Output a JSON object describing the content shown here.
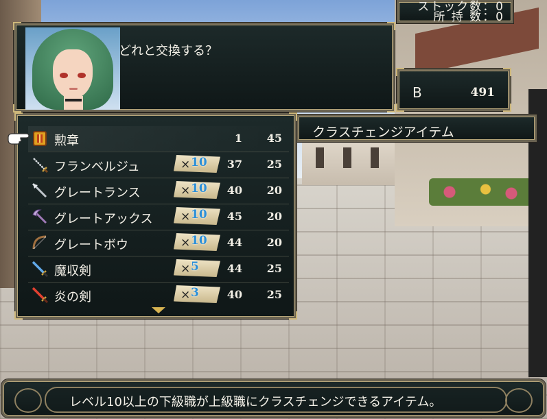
{
  "stock": {
    "stock_label": "ストック数：0",
    "owned_label": "所 持 数：0"
  },
  "dialog": {
    "text": "どれと交換する？"
  },
  "currency": {
    "label": "B",
    "value": "491"
  },
  "category": {
    "label": "クラスチェンジアイテム"
  },
  "items": [
    {
      "name": "勲章",
      "icon": "medal-icon",
      "multiplier": "",
      "qty": "1",
      "price": "45"
    },
    {
      "name": "フランベルジュ",
      "icon": "sword-icon",
      "multiplier": "10",
      "qty": "37",
      "price": "25"
    },
    {
      "name": "グレートランス",
      "icon": "lance-icon",
      "multiplier": "10",
      "qty": "40",
      "price": "20"
    },
    {
      "name": "グレートアックス",
      "icon": "axe-icon",
      "multiplier": "10",
      "qty": "45",
      "price": "20"
    },
    {
      "name": "グレートボウ",
      "icon": "bow-icon",
      "multiplier": "10",
      "qty": "44",
      "price": "20"
    },
    {
      "name": "魔収剣",
      "icon": "blue-sword-icon",
      "multiplier": "5",
      "qty": "44",
      "price": "25"
    },
    {
      "name": "炎の剣",
      "icon": "flame-sword-icon",
      "multiplier": "3",
      "qty": "40",
      "price": "25"
    }
  ],
  "multiplier_prefix": "×",
  "description": "レベル10以上の下級職が上級職にクラスチェンジできるアイテム。",
  "colors": {
    "panel_bg": "#0f1717",
    "frame_gold": "#cdb77a",
    "multiplier_number": "#2b8fd8"
  }
}
